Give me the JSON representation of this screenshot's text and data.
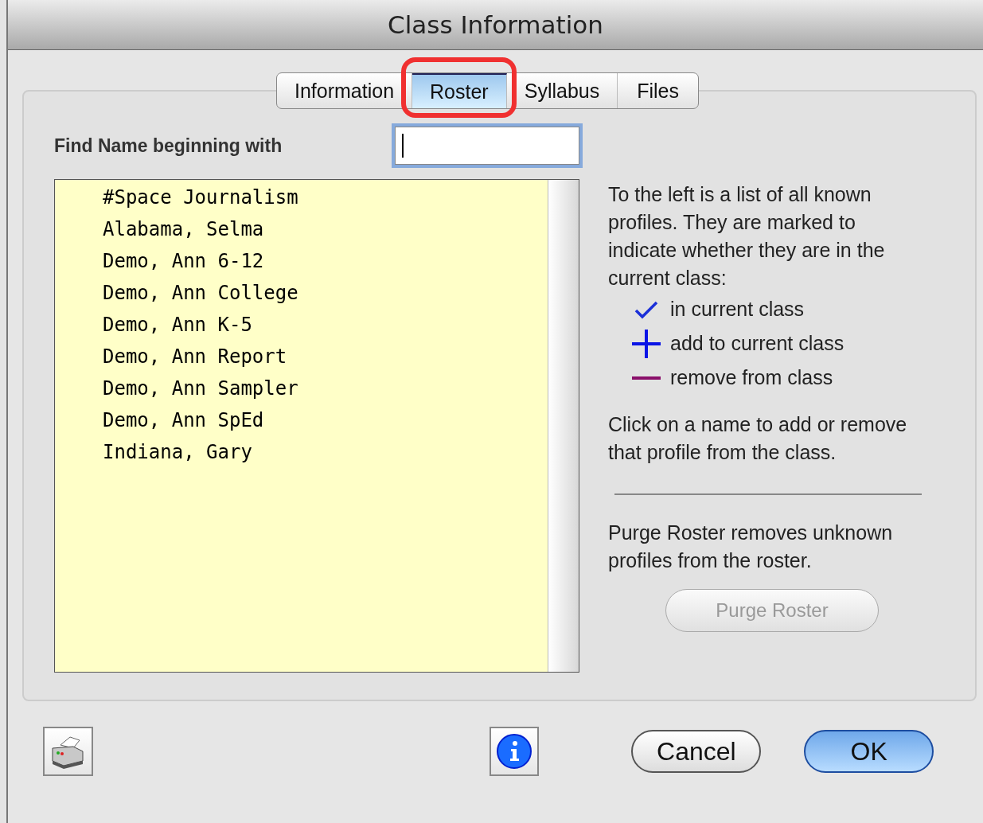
{
  "window": {
    "title": "Class Information"
  },
  "tabs": [
    {
      "label": "Information",
      "selected": false,
      "circled": false
    },
    {
      "label": "Roster",
      "selected": true,
      "circled": true
    },
    {
      "label": "Syllabus",
      "selected": false,
      "circled": false
    },
    {
      "label": "Files",
      "selected": false,
      "circled": false
    }
  ],
  "find": {
    "label": "Find Name beginning with",
    "focused": true
  },
  "names": [
    "#Space Journalism",
    "Alabama, Selma",
    "Demo, Ann 6-12",
    "Demo, Ann College",
    "Demo, Ann K-5",
    "Demo, Ann Report",
    "Demo, Ann Sampler",
    "Demo, Ann SpEd",
    "Indiana, Gary"
  ],
  "intro": "To the left is a list of all known profiles. They are marked to indicate whether they are in the current class:",
  "legend": [
    {
      "kind": "check",
      "text": "in current class"
    },
    {
      "kind": "plus",
      "text": "add to current class"
    },
    {
      "kind": "minus",
      "text": "remove from class"
    }
  ],
  "click_note": "Click on a name to add or remove that profile from the class.",
  "purge_note": "Purge Roster removes unknown profiles from the roster.",
  "purge_button": {
    "label": "Purge Roster",
    "disabled": true
  },
  "buttons": [
    {
      "label": "Cancel",
      "kind": "normal"
    },
    {
      "label": "OK",
      "kind": "default"
    }
  ]
}
